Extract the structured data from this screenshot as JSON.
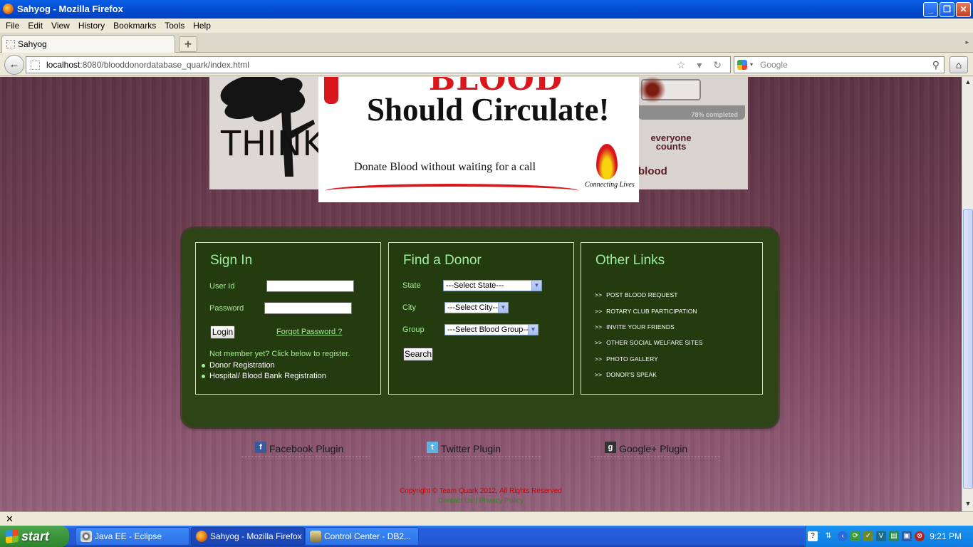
{
  "window": {
    "title": "Sahyog - Mozilla Firefox",
    "buttons": {
      "minimize": "_",
      "maximize": "❐",
      "close": "✕"
    }
  },
  "menu": [
    "File",
    "Edit",
    "View",
    "History",
    "Bookmarks",
    "Tools",
    "Help"
  ],
  "tab": {
    "title": "Sahyog",
    "new_tab": "+",
    "scroll": "▸"
  },
  "nav": {
    "url_host": "localhost",
    "url_rest": ":8080/blooddonordatabase_quark/index.html",
    "url_icons": "☆ ▾ ↻",
    "search_placeholder": "Google",
    "home": "⌂",
    "back": "←"
  },
  "banner": {
    "think": "THINK",
    "blood_head": "BLOOD",
    "headline": "Should Circulate!",
    "tagline": "Donate Blood without waiting for a call",
    "connecting": "Connecting Lives",
    "progress_label": "78% completed",
    "everyone": "everyone counts",
    "blood_word": "blood"
  },
  "signin": {
    "heading": "Sign In",
    "userid_label": "User Id",
    "password_label": "Password",
    "login_button": "Login",
    "forgot": "Forgot Password ?",
    "not_member": "Not member yet? Click below to register.",
    "registrations": [
      "Donor Registration",
      "Hospital/ Blood Bank Registration"
    ]
  },
  "find": {
    "heading": "Find a Donor",
    "state_label": "State",
    "state_value": "---Select State---",
    "city_label": "City",
    "city_value": "---Select City---",
    "group_label": "Group",
    "group_value": "---Select Blood Group---",
    "search_button": "Search"
  },
  "other_links": {
    "heading": "Other Links",
    "arrow": ">>",
    "items": [
      "POST BLOOD REQUEST",
      "ROTARY CLUB PARTICIPATION",
      "INVITE YOUR FRIENDS",
      "OTHER SOCIAL WELFARE SITES",
      "PHOTO GALLERY",
      "DONOR'S SPEAK"
    ]
  },
  "social": [
    {
      "icon": "f",
      "label": "Facebook Plugin"
    },
    {
      "icon": "t",
      "label": "Twitter Plugin"
    },
    {
      "icon": "g",
      "label": "Google+ Plugin"
    }
  ],
  "footer": {
    "copyright": "Copyright © Team Quark 2012, All Rights Reserved",
    "links": "Contact Us | Privacy Policy"
  },
  "statusbar": {
    "close": "✕"
  },
  "taskbar": {
    "start": "start",
    "tasks": [
      {
        "label": "Java EE - Eclipse",
        "active": false
      },
      {
        "label": "Sahyog - Mozilla Firefox",
        "active": true
      },
      {
        "label": "Control Center - DB2...",
        "active": false
      }
    ],
    "clock": "9:21 PM"
  },
  "colors": {
    "panel_heading": "#9df09d",
    "panel_label": "#a4ec8e",
    "green_box": "#2d4416",
    "copyright": "#d40000",
    "footer_links": "#2a8a1a"
  }
}
